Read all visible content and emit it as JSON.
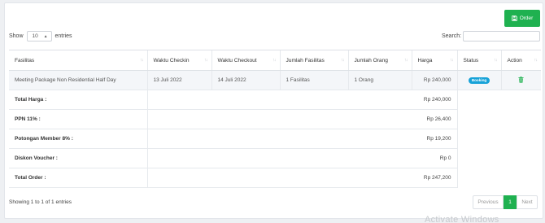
{
  "toolbar": {
    "order_label": "Order",
    "order_icon": "save-icon",
    "accent": "#1fb150"
  },
  "length": {
    "show_label": "Show",
    "value": "10",
    "suffix": "entries"
  },
  "search": {
    "label": "Search:",
    "value": ""
  },
  "table": {
    "headers": [
      "Fasilitas",
      "Waktu Checkin",
      "Waktu Checkout",
      "Jumlah Fasilitas",
      "Jumlah Orang",
      "Harga",
      "Status",
      "Action"
    ],
    "rows": [
      {
        "fasilitas": "Meeting Package Non Residential Half Day",
        "checkin": "13 Juli 2022",
        "checkout": "14 Juli 2022",
        "jumlah_fasilitas": "1 Fasilitas",
        "jumlah_orang": "1 Orang",
        "harga": "Rp 240,000",
        "status": "Booking",
        "status_color": "#17a2d8",
        "action_icon": "trash-icon",
        "action_color": "#1fb150"
      }
    ]
  },
  "summary": [
    {
      "label": "Total Harga :",
      "value": "Rp 240,000"
    },
    {
      "label": "PPN 11% :",
      "value": "Rp 26,400"
    },
    {
      "label": "Potongan Member 8% :",
      "value": "Rp 19,200"
    },
    {
      "label": "Diskon Voucher :",
      "value": "Rp 0"
    },
    {
      "label": "Total Order :",
      "value": "Rp 247,200"
    }
  ],
  "footer": {
    "info": "Showing 1 to 1 of 1 entries",
    "prev": "Previous",
    "current_page": "1",
    "next": "Next"
  },
  "watermark": "Activate Windows"
}
